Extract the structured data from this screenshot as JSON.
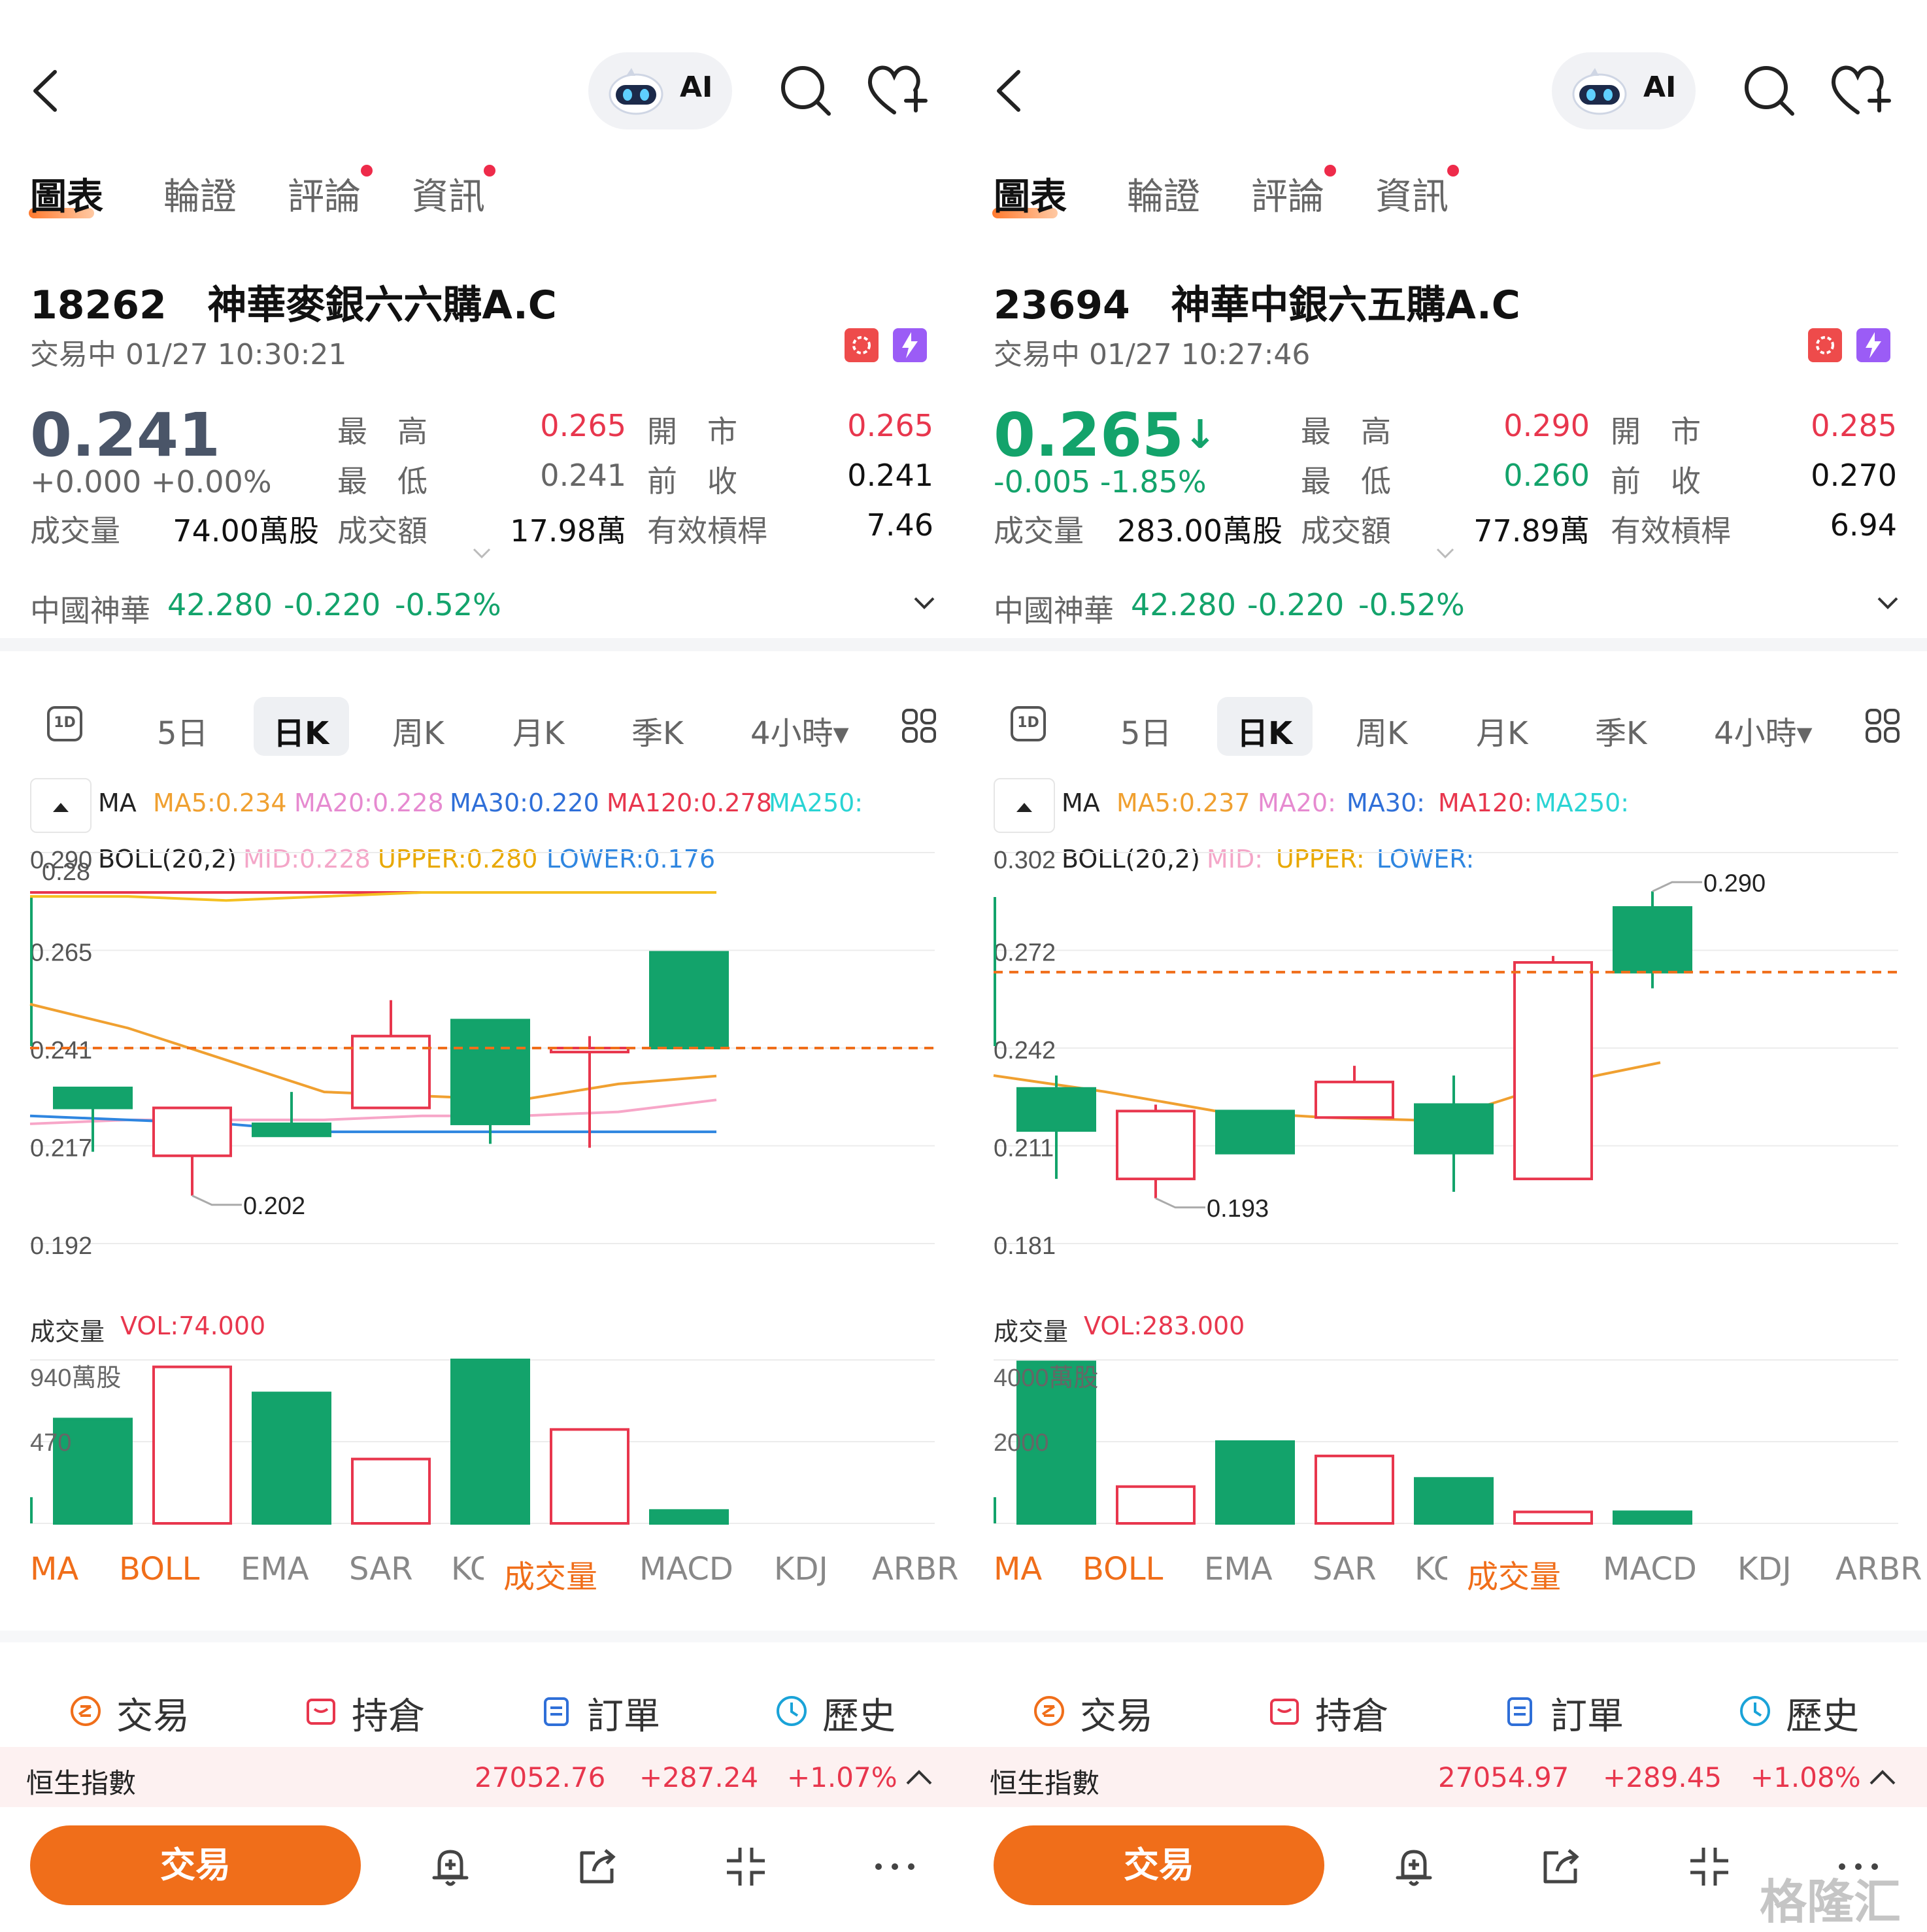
{
  "panels": [
    {
      "nav": {
        "ai_label": "AI"
      },
      "tabs": [
        {
          "label": "圖表",
          "active": true,
          "dot": false
        },
        {
          "label": "輪證",
          "active": false,
          "dot": false
        },
        {
          "label": "評論",
          "active": false,
          "dot": true
        },
        {
          "label": "資訊",
          "active": false,
          "dot": true
        }
      ],
      "stock": {
        "code": "18262",
        "name": "神華麥銀六六購A.C",
        "status": "交易中 01/27 10:30:21"
      },
      "quote": {
        "price": "0.241",
        "price_color": "#4a5568",
        "arrow": "",
        "change": "+0.000  +0.00%",
        "change_color": "#666666",
        "high_label": "最　高",
        "high": "0.265",
        "high_color": "#e8364d",
        "open_label": "開　市",
        "open": "0.265",
        "open_color": "#e8364d",
        "low_label": "最　低",
        "low": "0.241",
        "low_color": "#666666",
        "prev_label": "前　收",
        "prev": "0.241",
        "vol_label": "成交量",
        "vol": "74.00萬股",
        "amt_label": "成交額",
        "amt": "17.98萬",
        "lev_label": "有效槓桿",
        "lev": "7.46"
      },
      "underlying": {
        "name": "中國神華",
        "price": "42.280",
        "chg": "-0.220",
        "pct": "-0.52%",
        "color": "#13a36b"
      },
      "periods": [
        "5日",
        "日K",
        "周K",
        "月K",
        "季K",
        "4小時▾"
      ],
      "period_1d": "1D",
      "ma_legend": {
        "ma": "MA",
        "ma5": "MA5:0.234",
        "ma20": "MA20:0.228",
        "ma30": "MA30:0.220",
        "ma120": "MA120:0.278",
        "ma250": "MA250:"
      },
      "boll_legend": {
        "boll": "BOLL(20,2)",
        "mid": "MID:0.228",
        "upper": "UPPER:0.280",
        "lower": "LOWER:0.176"
      },
      "chart_data": {
        "type": "candlestick",
        "y_ticks": [
          "0.290",
          "0.265",
          "0.241",
          "0.217",
          "0.192"
        ],
        "ylim": [
          0.192,
          0.29
        ],
        "y_overlap_label": "0.28",
        "last_price_line": 0.241,
        "max_label": "",
        "min_label": "0.202",
        "candles": [
          {
            "o": 0.226,
            "h": 0.231,
            "l": 0.215,
            "c": 0.231,
            "up": false
          },
          {
            "o": 0.214,
            "h": 0.226,
            "l": 0.204,
            "c": 0.226,
            "up": true
          },
          {
            "o": 0.219,
            "h": 0.23,
            "l": 0.219,
            "c": 0.222,
            "up": false
          },
          {
            "o": 0.226,
            "h": 0.253,
            "l": 0.226,
            "c": 0.244,
            "up": true
          },
          {
            "o": 0.222,
            "h": 0.248,
            "l": 0.217,
            "c": 0.248,
            "up": false
          },
          {
            "o": 0.24,
            "h": 0.244,
            "l": 0.216,
            "c": 0.241,
            "up": true
          },
          {
            "o": 0.241,
            "h": 0.265,
            "l": 0.241,
            "c": 0.265,
            "up": false
          }
        ],
        "ma_lines": [
          {
            "color": "#f0a030",
            "values": [
              0.252,
              0.246,
              0.238,
              0.23,
              0.229,
              0.228,
              0.232,
              0.234
            ]
          },
          {
            "color": "#f7a6c8",
            "values": [
              0.222,
              0.223,
              0.223,
              0.223,
              0.224,
              0.224,
              0.225,
              0.228
            ]
          },
          {
            "color": "#2f86e0",
            "values": [
              0.224,
              0.223,
              0.222,
              0.22,
              0.22,
              0.22,
              0.22,
              0.22
            ]
          },
          {
            "color": "#e8364d",
            "values": [
              0.28,
              0.28,
              0.28,
              0.28,
              0.28,
              0.28,
              0.28,
              0.28
            ]
          },
          {
            "color": "#f4c020",
            "values": [
              0.279,
              0.279,
              0.278,
              0.279,
              0.28,
              0.28,
              0.28,
              0.28
            ]
          }
        ]
      },
      "volume": {
        "label": "成交量",
        "vol_text": "VOL:74.000",
        "y_ticks": [
          "940萬股",
          "470"
        ],
        "max": 940,
        "bars": [
          {
            "v": 600,
            "up": false
          },
          {
            "v": 900,
            "up": true
          },
          {
            "v": 750,
            "up": false
          },
          {
            "v": 370,
            "up": true
          },
          {
            "v": 940,
            "up": false
          },
          {
            "v": 540,
            "up": true
          },
          {
            "v": 74,
            "up": false
          }
        ]
      },
      "indicators": [
        {
          "label": "MA",
          "color": "#f06e1a"
        },
        {
          "label": "BOLL",
          "color": "#f06e1a"
        },
        {
          "label": "EMA",
          "color": "#888888"
        },
        {
          "label": "SAR",
          "color": "#888888"
        },
        {
          "label": "KC",
          "color": "#888888"
        },
        {
          "label": "成交量",
          "color": "#f06e1a"
        },
        {
          "label": "MACD",
          "color": "#888888"
        },
        {
          "label": "KDJ",
          "color": "#888888"
        },
        {
          "label": "ARBR",
          "color": "#888888"
        }
      ],
      "actions": [
        "交易",
        "持倉",
        "訂單",
        "歷史"
      ],
      "index": {
        "name": "恒生指數",
        "value": "27052.76",
        "chg": "+287.24",
        "pct": "+1.07%"
      },
      "trade_button": "交易"
    },
    {
      "nav": {
        "ai_label": "AI"
      },
      "tabs": [
        {
          "label": "圖表",
          "active": true,
          "dot": false
        },
        {
          "label": "輪證",
          "active": false,
          "dot": false
        },
        {
          "label": "評論",
          "active": false,
          "dot": true
        },
        {
          "label": "資訊",
          "active": false,
          "dot": true
        }
      ],
      "stock": {
        "code": "23694",
        "name": "神華中銀六五購A.C",
        "status": "交易中 01/27 10:27:46"
      },
      "quote": {
        "price": "0.265",
        "price_color": "#13a36b",
        "arrow": "↓",
        "change": "-0.005  -1.85%",
        "change_color": "#13a36b",
        "high_label": "最　高",
        "high": "0.290",
        "high_color": "#e8364d",
        "open_label": "開　市",
        "open": "0.285",
        "open_color": "#e8364d",
        "low_label": "最　低",
        "low": "0.260",
        "low_color": "#13a36b",
        "prev_label": "前　收",
        "prev": "0.270",
        "vol_label": "成交量",
        "vol": "283.00萬股",
        "amt_label": "成交額",
        "amt": "77.89萬",
        "lev_label": "有效槓桿",
        "lev": "6.94"
      },
      "underlying": {
        "name": "中國神華",
        "price": "42.280",
        "chg": "-0.220",
        "pct": "-0.52%",
        "color": "#13a36b"
      },
      "periods": [
        "5日",
        "日K",
        "周K",
        "月K",
        "季K",
        "4小時▾"
      ],
      "period_1d": "1D",
      "ma_legend": {
        "ma": "MA",
        "ma5": "MA5:0.237",
        "ma20": "MA20:",
        "ma30": "MA30:",
        "ma120": "MA120:",
        "ma250": "MA250:"
      },
      "boll_legend": {
        "boll": "BOLL(20,2)",
        "mid": "MID:",
        "upper": "UPPER:",
        "lower": "LOWER:"
      },
      "chart_data": {
        "type": "candlestick",
        "y_ticks": [
          "0.302",
          "0.272",
          "0.242",
          "0.211",
          "0.181"
        ],
        "ylim": [
          0.181,
          0.302
        ],
        "y_overlap_label": "",
        "last_price_line": 0.265,
        "max_label": "0.290",
        "min_label": "0.193",
        "candles": [
          {
            "o": 0.229,
            "h": 0.233,
            "l": 0.201,
            "c": 0.216,
            "up": false
          },
          {
            "o": 0.201,
            "h": 0.224,
            "l": 0.195,
            "c": 0.222,
            "up": true
          },
          {
            "o": 0.222,
            "h": 0.222,
            "l": 0.209,
            "c": 0.209,
            "up": false
          },
          {
            "o": 0.231,
            "h": 0.236,
            "l": 0.22,
            "c": 0.22,
            "up": true
          },
          {
            "o": 0.224,
            "h": 0.233,
            "l": 0.197,
            "c": 0.209,
            "up": false
          },
          {
            "o": 0.201,
            "h": 0.27,
            "l": 0.201,
            "c": 0.268,
            "up": true
          },
          {
            "o": 0.285,
            "h": 0.29,
            "l": 0.26,
            "c": 0.265,
            "up": false
          }
        ],
        "ma_lines": [
          {
            "color": "#f0a030",
            "values": [
              0.233,
              0.228,
              0.222,
              0.22,
              0.219,
              0.23,
              0.237
            ]
          }
        ]
      },
      "volume": {
        "label": "成交量",
        "vol_text": "VOL:283.000",
        "y_ticks": [
          "4000萬股",
          "2000"
        ],
        "max": 4000,
        "bars": [
          {
            "v": 3950,
            "up": false
          },
          {
            "v": 900,
            "up": true
          },
          {
            "v": 2000,
            "up": false
          },
          {
            "v": 1650,
            "up": true
          },
          {
            "v": 1100,
            "up": false
          },
          {
            "v": 280,
            "up": true
          },
          {
            "v": 283,
            "up": false
          }
        ]
      },
      "indicators": [
        {
          "label": "MA",
          "color": "#f06e1a"
        },
        {
          "label": "BOLL",
          "color": "#f06e1a"
        },
        {
          "label": "EMA",
          "color": "#888888"
        },
        {
          "label": "SAR",
          "color": "#888888"
        },
        {
          "label": "KC",
          "color": "#888888"
        },
        {
          "label": "成交量",
          "color": "#f06e1a"
        },
        {
          "label": "MACD",
          "color": "#888888"
        },
        {
          "label": "KDJ",
          "color": "#888888"
        },
        {
          "label": "ARBR",
          "color": "#888888"
        }
      ],
      "actions": [
        "交易",
        "持倉",
        "訂單",
        "歷史"
      ],
      "index": {
        "name": "恒生指數",
        "value": "27054.97",
        "chg": "+289.45",
        "pct": "+1.08%"
      },
      "trade_button": "交易"
    }
  ],
  "colors": {
    "up_red": "#e8364d",
    "down_green": "#13a36b",
    "accent_orange": "#f06e1a"
  },
  "watermark": "格隆汇"
}
